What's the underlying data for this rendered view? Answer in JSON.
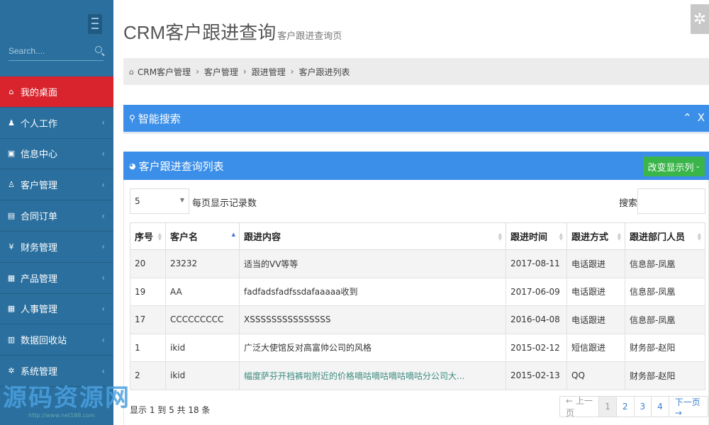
{
  "sidebar": {
    "search_placeholder": "Search....",
    "items": [
      {
        "label": "我的桌面",
        "icon": "home-icon",
        "glyph": "⌂",
        "active": true
      },
      {
        "label": "个人工作",
        "icon": "user-icon",
        "glyph": "♟"
      },
      {
        "label": "信息中心",
        "icon": "message-icon",
        "glyph": "▣"
      },
      {
        "label": "客户管理",
        "icon": "male-icon",
        "glyph": "♙"
      },
      {
        "label": "合同订单",
        "icon": "book-icon",
        "glyph": "▤"
      },
      {
        "label": "财务管理",
        "icon": "yen-icon",
        "glyph": "¥"
      },
      {
        "label": "产品管理",
        "icon": "table-icon",
        "glyph": "▦"
      },
      {
        "label": "人事管理",
        "icon": "table-icon",
        "glyph": "▦"
      },
      {
        "label": "数据回收站",
        "icon": "trash-icon",
        "glyph": "▥"
      },
      {
        "label": "系统管理",
        "icon": "gear-icon",
        "glyph": "✲"
      }
    ]
  },
  "header": {
    "title": "CRM客户跟进查询",
    "subtitle": "客户跟进查询页"
  },
  "breadcrumb": [
    "CRM客户管理",
    "客户管理",
    "跟进管理",
    "客户跟进列表"
  ],
  "search_panel": {
    "title": "智能搜索"
  },
  "list_panel": {
    "title": "客户跟进查询列表",
    "columns_button": "改变显示列",
    "page_length": "5",
    "page_length_label": "每页显示记录数",
    "search_label": "搜索:",
    "columns": [
      "序号",
      "客户名",
      "跟进内容",
      "跟进时间",
      "跟进方式",
      "跟进部门人员"
    ],
    "rows": [
      [
        "20",
        "23232",
        "适当的VV等等",
        "2017-08-11",
        "电话跟进",
        "信息部-凤凰"
      ],
      [
        "19",
        "AA",
        "fadfadsfadfssdafaaaaa收到",
        "2017-06-09",
        "电话跟进",
        "信息部-凤凰"
      ],
      [
        "17",
        "CCCCCCCCC",
        "XSSSSSSSSSSSSSSS",
        "2016-04-08",
        "电话跟进",
        "信息部-凤凰"
      ],
      [
        "1",
        "ikid",
        "广泛大使馆反对高富帅公司的风格",
        "2015-02-12",
        "短信跟进",
        "财务部-赵阳"
      ],
      [
        "2",
        "ikid",
        "幅度萨芬开裆裤啦附近的价格嘀咕嘀咕嘀咕嘀咕分公司大...",
        "2015-02-13",
        "QQ",
        "财务部-赵阳"
      ]
    ],
    "info": "显示 1 到 5 共 18 条",
    "pager": {
      "prev": "← 上一页",
      "pages": [
        "1",
        "2",
        "3",
        "4"
      ],
      "next": "下一页 →"
    }
  },
  "watermark": {
    "text": "源码资源网",
    "url": "http://www.net188.com"
  }
}
